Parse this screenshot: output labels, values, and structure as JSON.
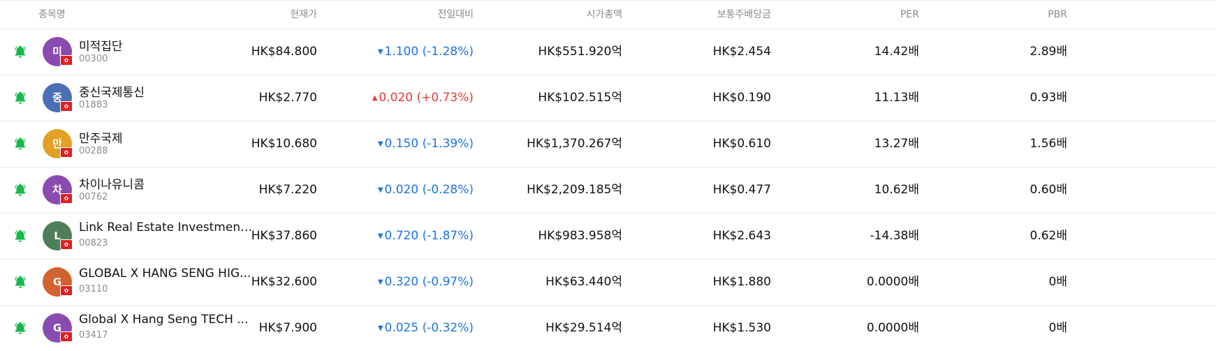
{
  "headers": {
    "name": "종목명",
    "price": "현재가",
    "change": "전일대비",
    "market_cap": "시가총액",
    "dividend": "보통주배당금",
    "per": "PER",
    "pbr": "PBR"
  },
  "colors": {
    "bell": "#19b84d",
    "down": "#1a73e8",
    "up": "#e53935"
  },
  "icons": {
    "alert": "bell-icon",
    "flag": "hong-kong-flag-icon"
  },
  "rows": [
    {
      "initial": "미",
      "avatar_color": "#8a4bb0",
      "name": "미적집단",
      "code": "00300",
      "price": "HK$84.800",
      "direction": "down",
      "arrow": "▼",
      "change": "1.100 (-1.28%)",
      "market_cap": "HK$551.920억",
      "dividend": "HK$2.454",
      "per": "14.42배",
      "pbr": "2.89배"
    },
    {
      "initial": "중",
      "avatar_color": "#4a6fb4",
      "name": "중신국제통신",
      "code": "01883",
      "price": "HK$2.770",
      "direction": "up",
      "arrow": "▲",
      "change": "0.020 (+0.73%)",
      "market_cap": "HK$102.515억",
      "dividend": "HK$0.190",
      "per": "11.13배",
      "pbr": "0.93배"
    },
    {
      "initial": "만",
      "avatar_color": "#e2a126",
      "name": "만주국제",
      "code": "00288",
      "price": "HK$10.680",
      "direction": "down",
      "arrow": "▼",
      "change": "0.150 (-1.39%)",
      "market_cap": "HK$1,370.267억",
      "dividend": "HK$0.610",
      "per": "13.27배",
      "pbr": "1.56배"
    },
    {
      "initial": "차",
      "avatar_color": "#8a4bb0",
      "name": "차이나유니콤",
      "code": "00762",
      "price": "HK$7.220",
      "direction": "down",
      "arrow": "▼",
      "change": "0.020 (-0.28%)",
      "market_cap": "HK$2,209.185억",
      "dividend": "HK$0.477",
      "per": "10.62배",
      "pbr": "0.60배"
    },
    {
      "initial": "L",
      "avatar_color": "#4e7f5a",
      "name": "Link Real Estate Investment...",
      "code": "00823",
      "price": "HK$37.860",
      "direction": "down",
      "arrow": "▼",
      "change": "0.720 (-1.87%)",
      "market_cap": "HK$983.958억",
      "dividend": "HK$2.643",
      "per": "-14.38배",
      "pbr": "0.62배"
    },
    {
      "initial": "G",
      "avatar_color": "#d2622e",
      "name": "GLOBAL X HANG SENG HIG...",
      "code": "03110",
      "price": "HK$32.600",
      "direction": "down",
      "arrow": "▼",
      "change": "0.320 (-0.97%)",
      "market_cap": "HK$63.440억",
      "dividend": "HK$1.880",
      "per": "0.0000배",
      "pbr": "0배"
    },
    {
      "initial": "G",
      "avatar_color": "#8a4bb0",
      "name": "Global X Hang Seng TECH ...",
      "code": "03417",
      "price": "HK$7.900",
      "direction": "down",
      "arrow": "▼",
      "change": "0.025 (-0.32%)",
      "market_cap": "HK$29.514억",
      "dividend": "HK$1.530",
      "per": "0.0000배",
      "pbr": "0배"
    }
  ]
}
